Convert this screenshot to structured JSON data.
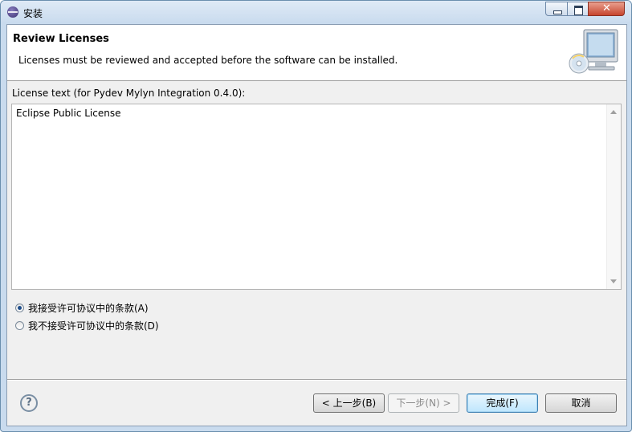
{
  "window": {
    "title": "安装"
  },
  "header": {
    "title": "Review Licenses",
    "description": "Licenses must be reviewed and accepted before the software can be installed."
  },
  "license": {
    "label": "License text (for Pydev Mylyn Integration 0.4.0):",
    "text": "Eclipse Public License"
  },
  "options": {
    "accept": {
      "label": "我接受许可协议中的条款(A)",
      "selected": true
    },
    "decline": {
      "label": "我不接受许可协议中的条款(D)",
      "selected": false
    }
  },
  "buttons": {
    "back": "< 上一步(B)",
    "next": "下一步(N) >",
    "finish": "完成(F)",
    "cancel": "取消"
  },
  "icons": {
    "app": "eclipse-icon",
    "help": "help-icon",
    "header_graphic": "install-computer-icon"
  }
}
